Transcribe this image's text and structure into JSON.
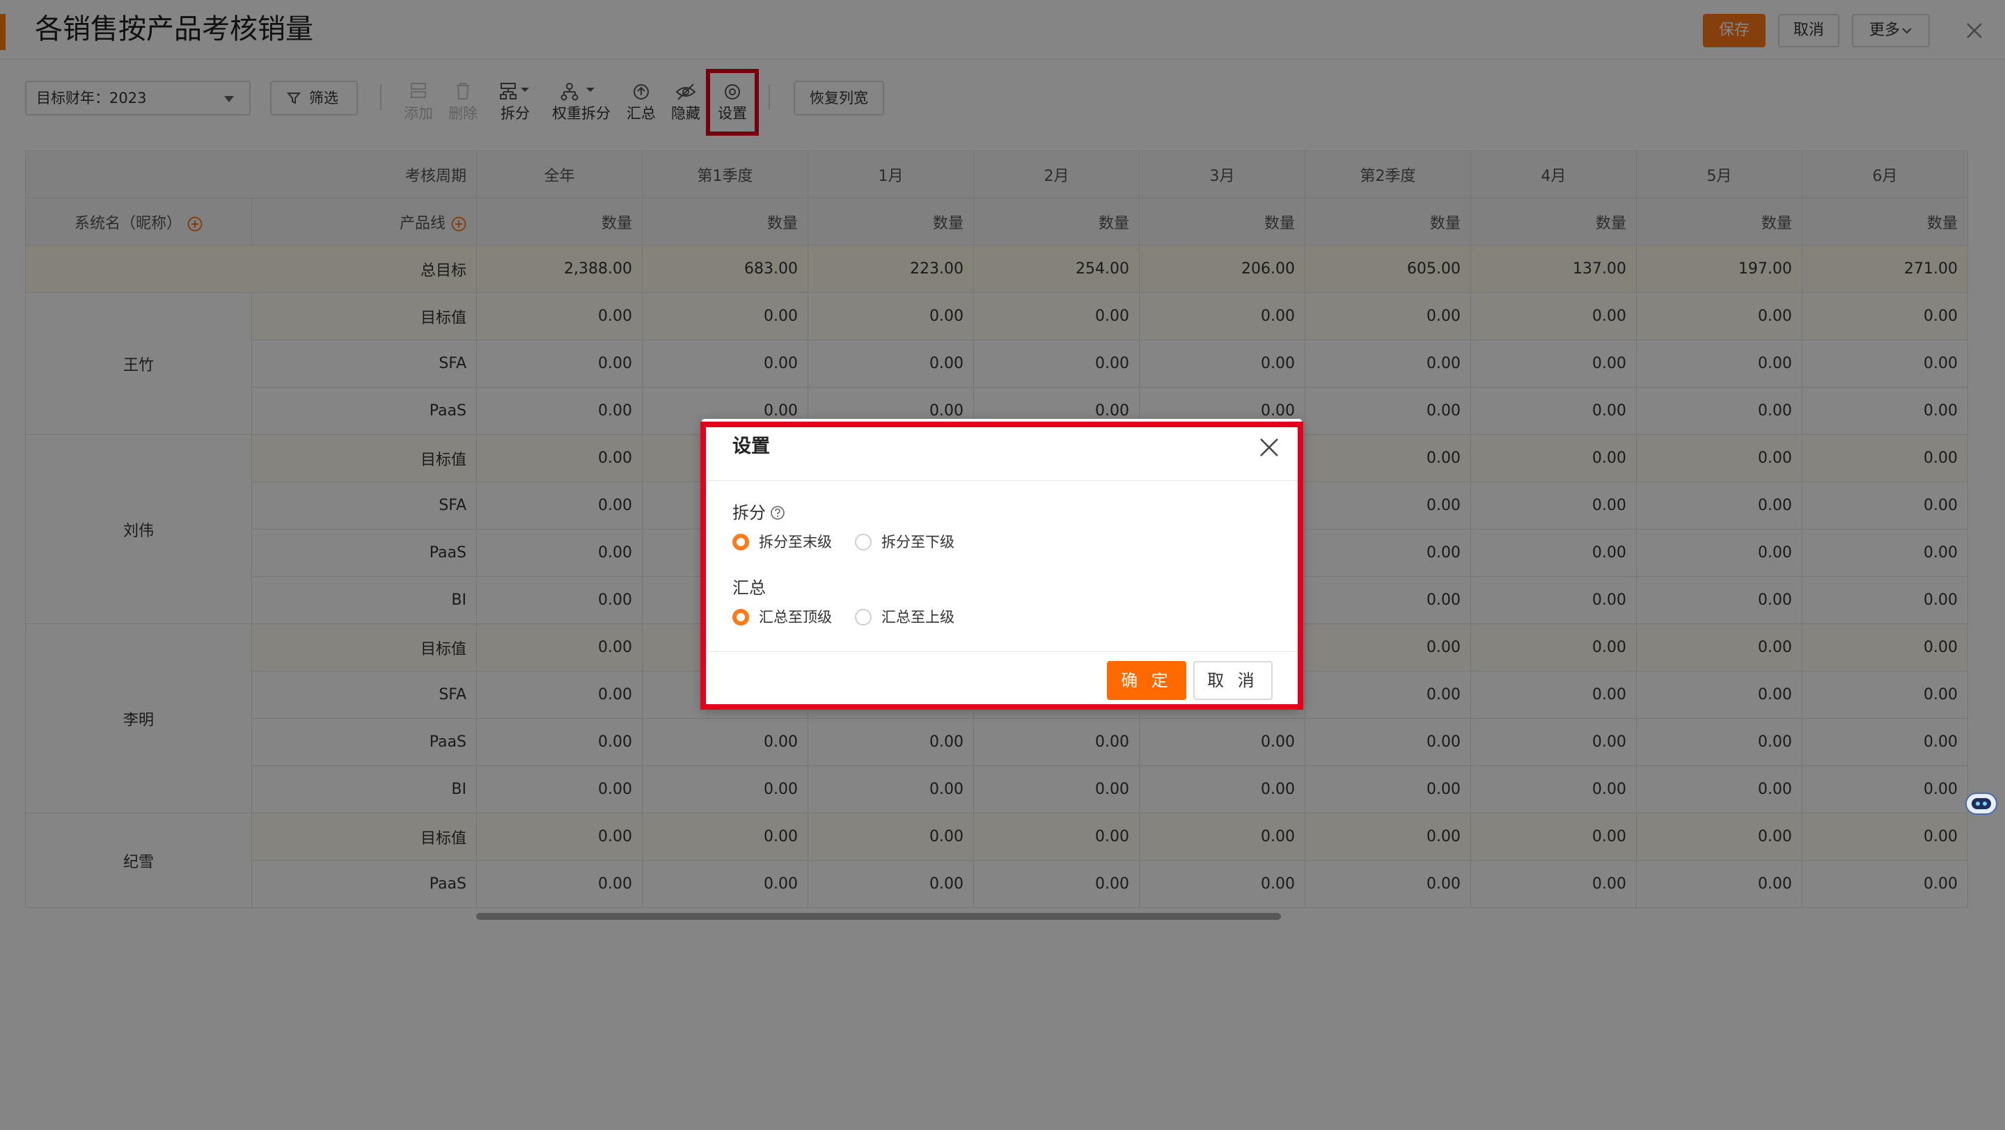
{
  "header": {
    "title": "各销售按产品考核销量",
    "save": "保存",
    "cancel": "取消",
    "more": "更多"
  },
  "toolbar": {
    "year_label": "目标财年：2023",
    "filter": "筛选",
    "add": "添加",
    "delete": "删除",
    "split": "拆分",
    "weighted_split": "权重拆分",
    "summary": "汇总",
    "hide": "隐藏",
    "settings": "设置",
    "restore_width": "恢复列宽"
  },
  "table": {
    "period_label": "考核周期",
    "system_name_label": "系统名（昵称）",
    "product_line_label": "产品线",
    "periods": [
      "全年",
      "第1季度",
      "1月",
      "2月",
      "3月",
      "第2季度",
      "4月",
      "5月",
      "6月"
    ],
    "measure": "数量",
    "total_label": "总目标",
    "total_values": [
      "2,388.00",
      "683.00",
      "223.00",
      "254.00",
      "206.00",
      "605.00",
      "137.00",
      "197.00",
      "271.00"
    ],
    "zero": "0.00",
    "groups": [
      {
        "name": "王竹",
        "lines": [
          "目标值",
          "SFA",
          "PaaS"
        ]
      },
      {
        "name": "刘伟",
        "lines": [
          "目标值",
          "SFA",
          "PaaS",
          "BI"
        ]
      },
      {
        "name": "李明",
        "lines": [
          "目标值",
          "SFA",
          "PaaS",
          "BI"
        ]
      },
      {
        "name": "纪雪",
        "lines": [
          "目标值",
          "PaaS"
        ]
      }
    ]
  },
  "dialog": {
    "title": "设置",
    "split_label": "拆分",
    "split_options": [
      "拆分至末级",
      "拆分至下级"
    ],
    "split_selected": 0,
    "summary_label": "汇总",
    "summary_options": [
      "汇总至顶级",
      "汇总至上级"
    ],
    "summary_selected": 0,
    "ok": "确 定",
    "cancel": "取 消"
  },
  "colors": {
    "accent": "#ff7a1a",
    "highlight": "#e4001b"
  }
}
